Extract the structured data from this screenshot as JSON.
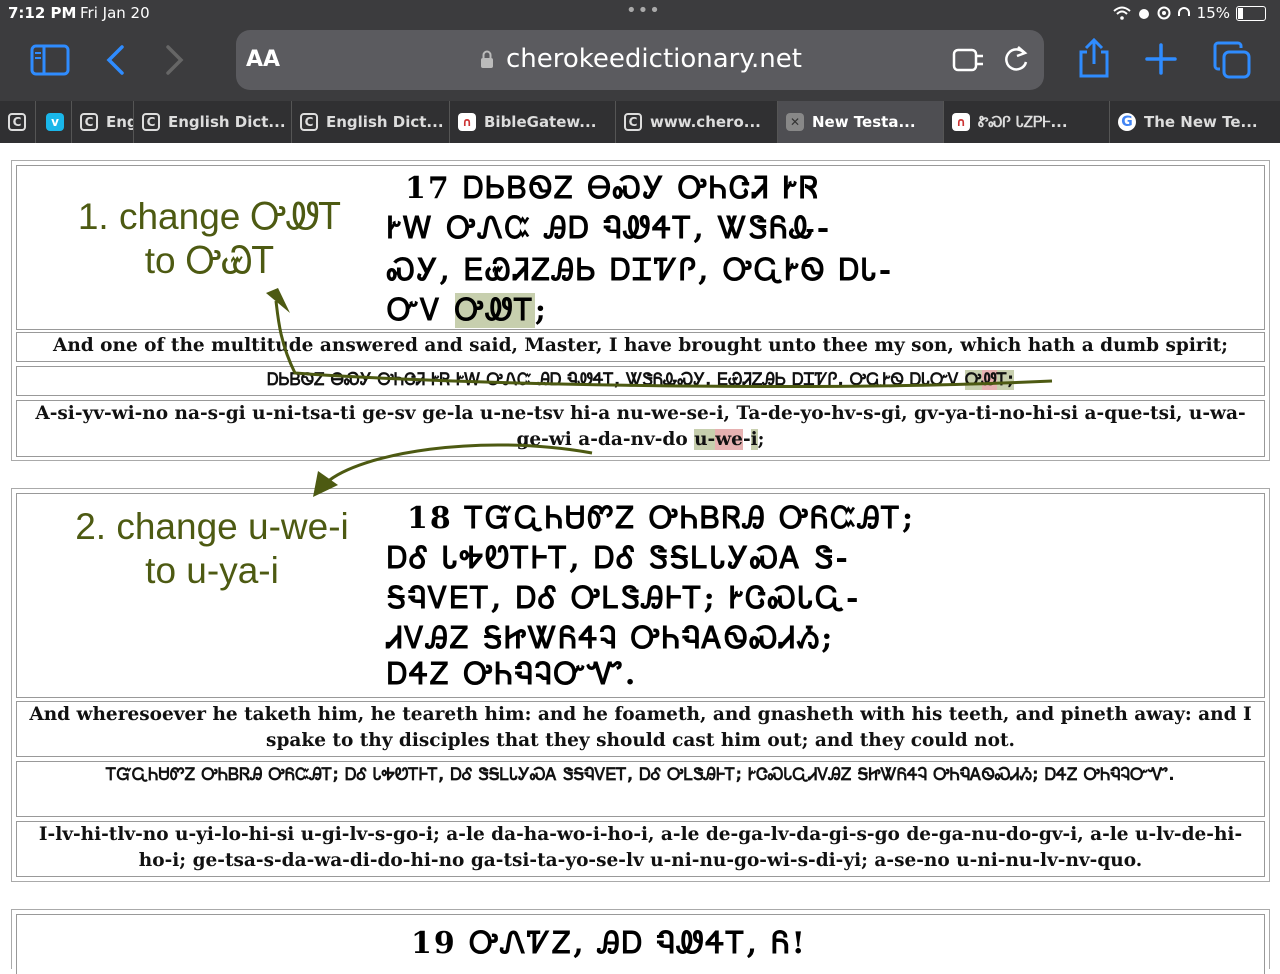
{
  "status": {
    "time": "7:12 PM",
    "date": "Fri Jan 20",
    "battery": "15%",
    "dots": "•••"
  },
  "toolbar": {
    "aa": "AA",
    "url": "cherokeedictionary.net",
    "sidebar_icon": "sidebar-icon",
    "accent": "#2f8cff"
  },
  "tabs": [
    {
      "label": "",
      "icon": "C"
    },
    {
      "label": "",
      "icon": "v"
    },
    {
      "label": "Eng",
      "icon": "C"
    },
    {
      "label": "English Dict...",
      "icon": "C"
    },
    {
      "label": "English Dict...",
      "icon": "C"
    },
    {
      "label": "BibleGatew...",
      "icon": "∩"
    },
    {
      "label": "www.chero...",
      "icon": "C"
    },
    {
      "label": "New Testa...",
      "icon": "✕"
    },
    {
      "label": "ᏑᏍᎵ ᏓᏃᏢᎰ...",
      "icon": "∩"
    },
    {
      "label": "The New Te...",
      "icon": "G"
    }
  ],
  "annotations": {
    "a1_line1": "1. change ᎤᏪᎢ",
    "a1_line2": "to ᎤᏯᎢ",
    "a2_line1": "2. change u-we-i",
    "a2_line2": "to u-ya-i"
  },
  "v17": {
    "syll1": "17 ᎠᏏᏴᏫᏃ ᎾᏍᎩ ᎤᏂᏣᏘ ᎨᏒ",
    "syll2": "ᎨᎳ ᎤᏁᏨ ᎯᎠ ᏄᏪᏎᎢ, ᏔᏕᏲᎲ-",
    "syll3": "ᏍᎩ, ᎬᏯᏘᏃᎯᏏ ᎠᏆᏤᎵ, ᎤᏩᎨᏫ ᎠᏓ-",
    "syll4a": "ᏅᏙ ",
    "syll4b": "ᎤᏪᎢ",
    "syll4c": ";",
    "english": "And one of the multitude answered and said, Master, I have brought unto thee my son, which hath a dumb spirit;",
    "cherokee_a": "ᎠᏏᏴᏫᏃ ᎾᏍᎩ ᎤᏂᏣᏘ ᎨᏒ ᎨᎳ ᎤᏁᏨ ᎯᎠ ᏄᏪᏎᎢ, ᏔᏕᏲᎲᏍᎩ, ᎬᏯᏘᏃᎯᏏ ᎠᏆᏤᎵ, ᎤᏩᎨᏫ ᎠᏓᏅᏙ ",
    "cherokee_u": "Ꭴ",
    "cherokee_we": "Ꮺ",
    "cherokee_end": "Ꭲ;",
    "translit_a": "A-si-yv-wi-no na-s-gi u-ni-tsa-ti ge-sv ge-la u-ne-tsv hi-a nu-we-se-i, Ta-de-yo-hv-s-gi, gv-ya-ti-no-hi-si a-que-tsi, u-wa-ge-wi a-da-nv-do ",
    "translit_u": "u-",
    "translit_we": "we",
    "translit_sep": "-",
    "translit_i": "i",
    "translit_end": ";"
  },
  "v18": {
    "syll1": "18 ᎢᏳᏩᏂᏌᏛᏃ ᎤᏂᏴᏒᎯ ᎤᏲᏨᎯᎢ;",
    "syll2": "ᎠᎴ ᏓᎭᏬᎢᎰᎢ, ᎠᎴ ᏕᎦᏞᏓᎩᏍᎪ Ꮥ-",
    "syll3": "ᎦᏄᏙᎬᎢ, ᎠᎴ ᎤᏞᏕᎯᎰᎢ; ᎨᏣᏍᏓᏩ-",
    "syll4": "ᏗᏙᎯᏃ ᎦᏥᏔᏲᏎᎸ ᎤᏂᏄᎪᏫᏍᏗᏱ;",
    "syll5": "ᎠᏎᏃ ᎤᏂᏄᎸᏅᏉ.",
    "english": "And wheresoever he taketh him, he teareth him: and he foameth, and gnasheth with his teeth, and pineth away: and I spake to thy disciples that they should cast him out; and they could not.",
    "cherokee": "ᎢᏳᏩᏂᏌᏛᏃ ᎤᏂᏴᏒᎯ ᎤᏲᏨᎯᎢ; ᎠᎴ ᏓᎭᏬᎢᎰᎢ, ᎠᎴ ᏕᎦᏞᏓᎩᏍᎪ ᏕᎦᏄᏙᎬᎢ, ᎠᎴ ᎤᏞᏕᎯᎰᎢ; ᎨᏣᏍᏓᏩᏗᏙᎯᏃ ᎦᏥᏔᏲᏎᎸ ᎤᏂᏄᎪᏫᏍᏗᏱ; ᎠᏎᏃ ᎤᏂᏄᎸᏅᏉ.",
    "translit": "I-lv-hi-tlv-no u-yi-lo-hi-si u-gi-lv-s-go-i; a-le da-ha-wo-i-ho-i, a-le de-ga-lv-da-gi-s-go de-ga-nu-do-gv-i, a-le u-lv-de-hi-ho-i; ge-tsa-s-da-wa-di-do-hi-no ga-tsi-ta-yo-se-lv u-ni-nu-go-wi-s-di-yi; a-se-no u-ni-nu-lv-nv-quo."
  },
  "v19": {
    "syll1": "19 ᎤᏁᏤᏃ, ᎯᎠ ᏄᏪᏎᎢ, Ᏺ!"
  }
}
